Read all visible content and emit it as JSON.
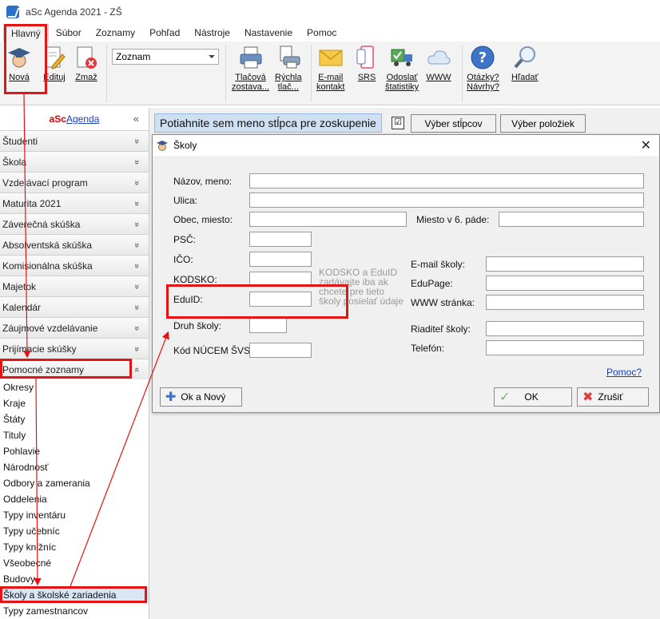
{
  "window": {
    "title": "aSc Agenda 2021 - ZŠ"
  },
  "menu": {
    "tabs": [
      "Hlavný",
      "Súbor",
      "Zoznamy",
      "Pohľad",
      "Nástroje",
      "Nastavenie",
      "Pomoc"
    ]
  },
  "ribbon": {
    "nova": "Nová",
    "edituj": "Edituj",
    "zmaz": "Zmaž",
    "combo_value": "Zoznam",
    "tlacova_1": "Tlačová",
    "tlacova_2": "zostava...",
    "rychla_1": "Rýchla",
    "rychla_2": "tlač...",
    "email_1": "E-mail",
    "email_2": "kontakt",
    "srs": "SRS",
    "odoslat_1": "Odoslať",
    "odoslat_2": "štatistiky",
    "www": "WWW",
    "otazky_1": "Otázky?",
    "otazky_2": "Návrhy?",
    "hladat": "Hľadať"
  },
  "sidebar": {
    "brand_a": "aSc",
    "brand_b": "Agenda",
    "collapse": "«",
    "groups": [
      "Študenti",
      "Škola",
      "Vzdelávací program",
      "Maturita 2021",
      "Záverečná skúška",
      "Absolventská skúška",
      "Komisionálna skúška",
      "Majetok",
      "Kalendár",
      "Záujmové vzdelávanie",
      "Prijímacie skúšky",
      "Pomocné zoznamy"
    ],
    "chev_down": "»",
    "chev_up": "«",
    "items": [
      "Okresy",
      "Kraje",
      "Štáty",
      "Tituly",
      "Pohlavie",
      "Národnosť",
      "Odbory a zamerania",
      "Oddelenia",
      "Typy inventáru",
      "Typy učebníc",
      "Typy knižníc",
      "Všeobecné",
      "Budovy",
      "Školy a školské zariadenia",
      "Typy zamestnancov"
    ]
  },
  "grid": {
    "group_hint": "Potiahnite sem meno stĺpca pre zoskupenie",
    "check_mark": "☑",
    "vyber_stlpcov": "Výber stĺpcov",
    "vyber_poloziek": "Výber položiek"
  },
  "dialog": {
    "title": "Školy",
    "close": "✕",
    "fields": {
      "nazov": "Názov, meno:",
      "ulica": "Ulica:",
      "obec": "Obec, miesto:",
      "miesto6": "Miesto v 6. páde:",
      "psc": "PSČ:",
      "ico": "IČO:",
      "kodsko": "KODSKO:",
      "eduid": "EduID:",
      "druh": "Druh školy:",
      "kod": "Kód NÚCEM ŠVS:",
      "email": "E-mail školy:",
      "edupage": "EduPage:",
      "www": "WWW stránka:",
      "riaditel": "Riaditeľ školy:",
      "telefon": "Telefón:"
    },
    "note": "KODSKO a EduID zadávajte iba ak chcete pre tieto školy posielať údaje",
    "help": "Pomoc?",
    "ok_novy": "Ok a Nový",
    "ok": "OK",
    "zrusit": "Zrušiť"
  },
  "colors": {
    "highlight": "#e41414",
    "accent": "#2b6fc9"
  }
}
